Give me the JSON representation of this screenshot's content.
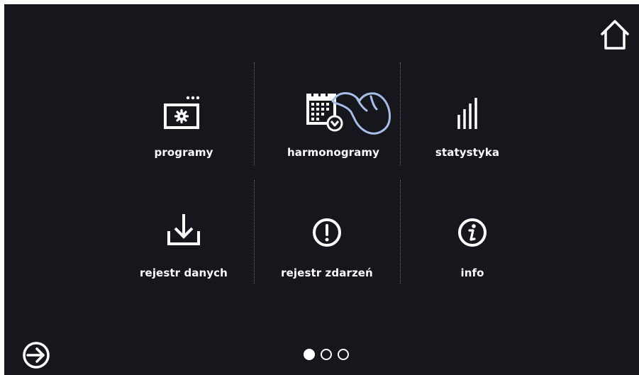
{
  "menu": {
    "tiles": [
      {
        "label": "programy",
        "icon": "programs-icon"
      },
      {
        "label": "harmonogramy",
        "icon": "schedule-calendar-icon"
      },
      {
        "label": "statystyka",
        "icon": "statistics-bars-icon"
      },
      {
        "label": "rejestr danych",
        "icon": "download-icon"
      },
      {
        "label": "rejestr zdarzeń",
        "icon": "alert-icon"
      },
      {
        "label": "info",
        "icon": "info-icon"
      }
    ]
  },
  "top_bar": {
    "home_icon": "home-icon"
  },
  "bottom_bar": {
    "logout_icon": "logout-icon",
    "pagination": {
      "current_page": 1,
      "total_pages": 3
    }
  },
  "overlay": {
    "gesture_icon": "tap-hand-icon"
  },
  "colors": {
    "background": "#16171c",
    "foreground": "#ffffff",
    "divider": "#6a6d78",
    "hand_outline": "#a9bde8"
  }
}
